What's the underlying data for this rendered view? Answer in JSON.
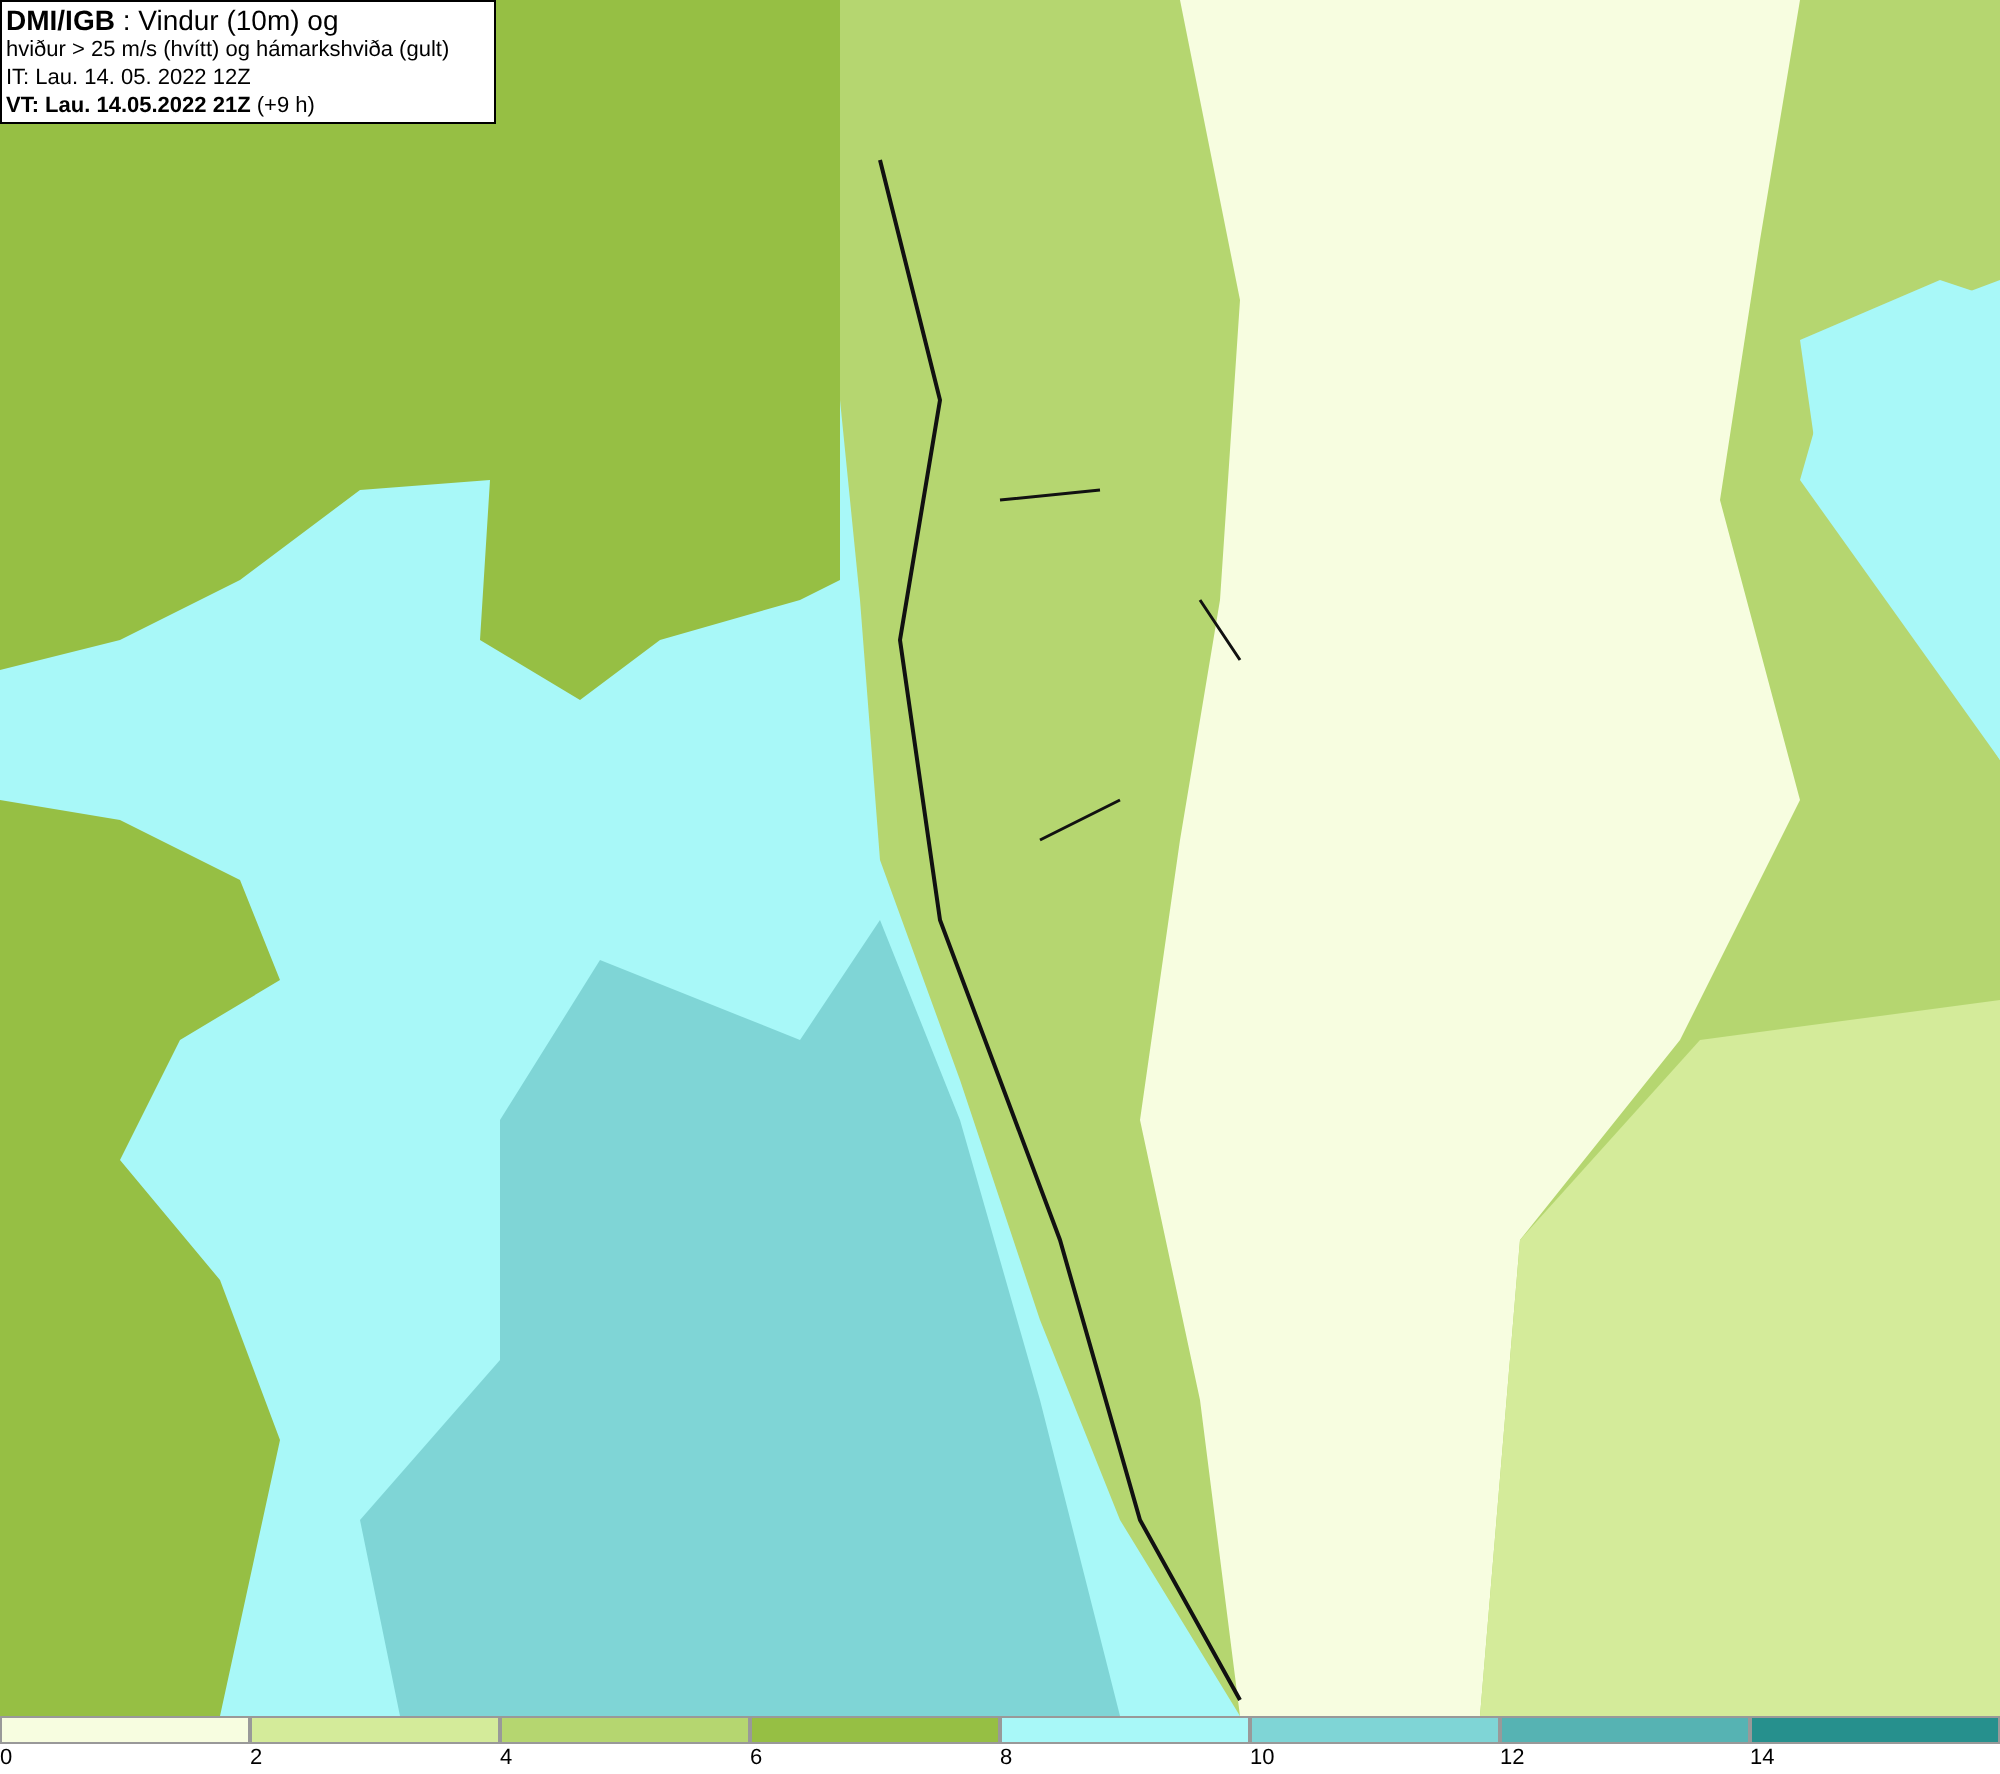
{
  "header": {
    "lines": [
      "**DMI/IGB** : Vindur (10m) og",
      "hviður > 25 m/s (hvítt) og hámarkshviða (gult)",
      "IT: Lau. 14. 05. 2022 12Z",
      "**VT: Lau. 14.05.2022 21Z** (+9 h)"
    ]
  },
  "legend": [
    {
      "color": "#f7fde0",
      "label": "0"
    },
    {
      "color": "#d4eb9a",
      "label": "2"
    },
    {
      "color": "#b5d670",
      "label": "4"
    },
    {
      "color": "#96bf44",
      "label": "6"
    },
    {
      "color": "#a8f8f8",
      "label": "8"
    },
    {
      "color": "#7fd5d6",
      "label": "10"
    },
    {
      "color": "#56b3b3",
      "label": "12"
    },
    {
      "color": "#26908d",
      "label": "14"
    }
  ]
}
